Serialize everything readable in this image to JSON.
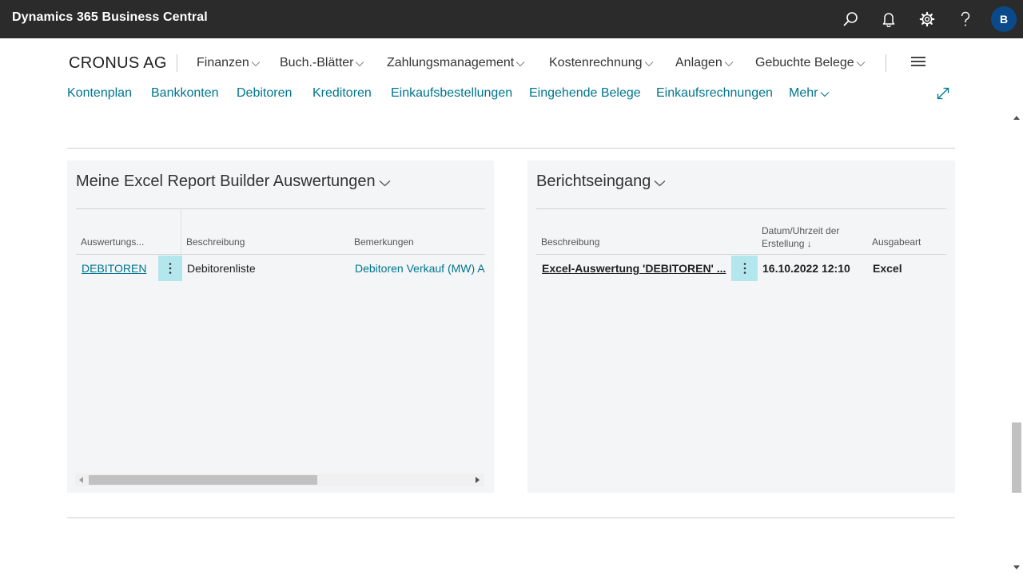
{
  "app": {
    "title": "Dynamics 365 Business Central",
    "user_initial": "B"
  },
  "topbar_icons": [
    "search-icon",
    "bell-icon",
    "gear-icon",
    "help-icon"
  ],
  "nav": {
    "company": "CRONUS AG",
    "menus": [
      "Finanzen",
      "Buch.-Blätter",
      "Zahlungsmanagement",
      "Kostenrechnung",
      "Anlagen",
      "Gebuchte Belege"
    ]
  },
  "actions": [
    "Kontenplan",
    "Bankkonten",
    "Debitoren",
    "Kreditoren",
    "Einkaufsbestellungen",
    "Eingehende Belege",
    "Einkaufsrechnungen",
    "Mehr"
  ],
  "excel_panel": {
    "title": "Meine Excel Report Builder Auswertungen",
    "columns": [
      "Auswertungs...",
      "Beschreibung",
      "Bemerkungen"
    ],
    "rows": [
      {
        "code": "DEBITOREN",
        "description": "Debitorenliste",
        "remarks": "Debitoren Verkauf (MW) A"
      }
    ]
  },
  "inbox_panel": {
    "title": "Berichtseingang",
    "columns": [
      "Beschreibung",
      "Datum/Uhrzeit der",
      "Erstellung",
      "Ausgabeart"
    ],
    "sort_indicator": "↓",
    "rows": [
      {
        "description": "Excel-Auswertung 'DEBITOREN' ...",
        "datetime": "16.10.2022 12:10",
        "output": "Excel"
      }
    ]
  },
  "colors": {
    "topbar": "#2b2b2b",
    "accent_link": "#00758f",
    "avatar": "#0b4a8a",
    "row_action": "#b4e6ee",
    "panel_bg": "#f4f5f6"
  }
}
